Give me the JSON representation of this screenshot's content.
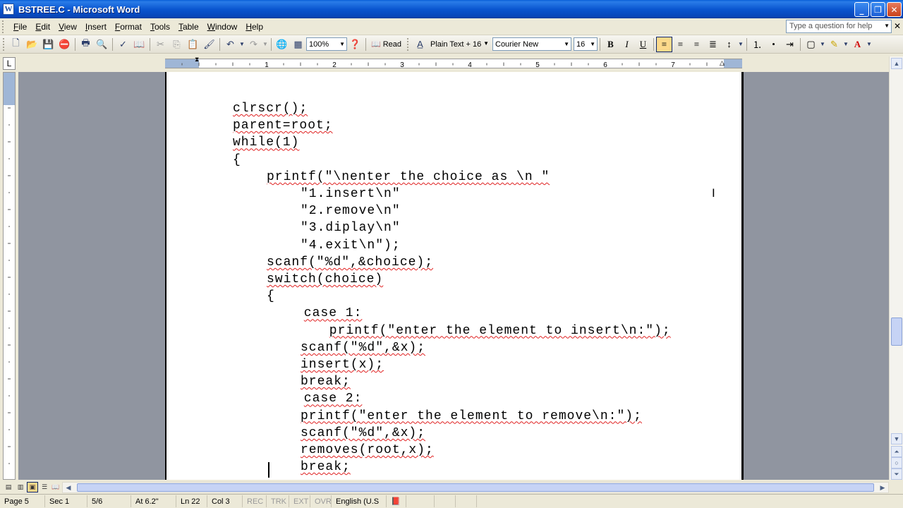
{
  "window": {
    "icon_letter": "W",
    "title": "BSTREE.C - Microsoft Word",
    "buttons": {
      "minimize": "_",
      "maximize": "❐",
      "close": "✕"
    }
  },
  "menus": [
    {
      "label": "File",
      "accel": "F",
      "rest": "ile"
    },
    {
      "label": "Edit",
      "accel": "E",
      "rest": "dit"
    },
    {
      "label": "View",
      "accel": "V",
      "rest": "iew"
    },
    {
      "label": "Insert",
      "accel": "I",
      "rest": "nsert"
    },
    {
      "label": "Format",
      "accel": "F",
      "rest": "ormat"
    },
    {
      "label": "Tools",
      "accel": "T",
      "rest": "ools"
    },
    {
      "label": "Table",
      "accel": "T",
      "rest": "able"
    },
    {
      "label": "Window",
      "accel": "W",
      "rest": "indow"
    },
    {
      "label": "Help",
      "accel": "H",
      "rest": "elp"
    }
  ],
  "help_box": {
    "placeholder": "Type a question for help"
  },
  "toolbar": {
    "zoom": "100%",
    "read_label": "Read",
    "style": "Plain Text + 16",
    "font": "Courier New",
    "size": "16",
    "bold": "B",
    "italic": "I",
    "underline": "U"
  },
  "ruler": {
    "corner_glyph": "L",
    "numbers": [
      "1",
      "2",
      "3",
      "4",
      "5",
      "6",
      "7"
    ]
  },
  "document": {
    "lines": [
      {
        "indent": 0,
        "text": "clrscr();",
        "spell": true
      },
      {
        "indent": 0,
        "text": "parent=root;",
        "spell": true
      },
      {
        "indent": 0,
        "text": "while(1)",
        "spell": true
      },
      {
        "indent": 0,
        "text": "{",
        "spell": false
      },
      {
        "indent": 1,
        "text": "printf(\"\\nenter the choice as \\n \"",
        "spell": true
      },
      {
        "indent": 2,
        "text": "\"1.insert\\n\"",
        "spell": false
      },
      {
        "indent": 2,
        "text": "\"2.remove\\n\"",
        "spell": false
      },
      {
        "indent": 2,
        "text": "\"3.diplay\\n\"",
        "spell": false
      },
      {
        "indent": 2,
        "text": "\"4.exit\\n\");",
        "spell": false
      },
      {
        "indent": 1,
        "text": "scanf(\"%d\",&choice);",
        "spell": true
      },
      {
        "indent": 1,
        "text": "switch(choice)",
        "spell": true
      },
      {
        "indent": 1,
        "text": "{",
        "spell": false
      },
      {
        "indent": 2.1,
        "text": "case 1:",
        "spell": true
      },
      {
        "indent": 2.85,
        "text": "printf(\"enter the element to insert\\n:\");",
        "spell": true
      },
      {
        "indent": 2,
        "text": "scanf(\"%d\",&x);",
        "spell": true
      },
      {
        "indent": 2,
        "text": "insert(x);",
        "spell": true
      },
      {
        "indent": 2,
        "text": "break;",
        "spell": true
      },
      {
        "indent": 2.1,
        "text": "case 2:",
        "spell": true
      },
      {
        "indent": 2,
        "text": "printf(\"enter the element to remove\\n:\");",
        "spell": true
      },
      {
        "indent": 2,
        "text": "scanf(\"%d\",&x);",
        "spell": true
      },
      {
        "indent": 2,
        "text": "removes(root,x);",
        "spell": true
      },
      {
        "indent": 2,
        "text": "break;",
        "spell": true
      }
    ]
  },
  "status": {
    "page": "Page 5",
    "sec": "Sec 1",
    "pages": "5/6",
    "at": "At 6.2\"",
    "ln": "Ln 22",
    "col": "Col 3",
    "rec": "REC",
    "trk": "TRK",
    "ext": "EXT",
    "ovr": "OVR",
    "language": "English (U.S"
  },
  "colors": {
    "titlebar": "#0a56d0",
    "active_button": "#fcd98b",
    "spell_error": "#e02020",
    "workspace": "#9095a0"
  }
}
